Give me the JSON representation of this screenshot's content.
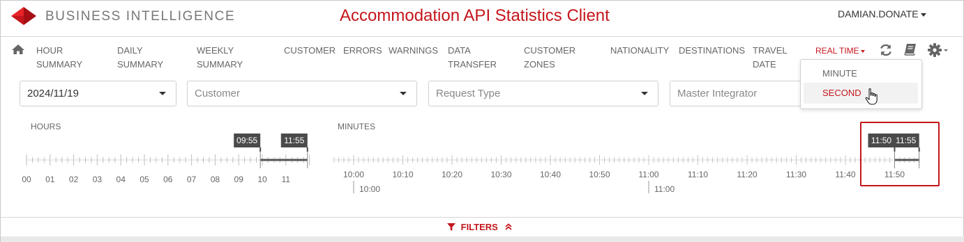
{
  "header": {
    "brand": "BUSINESS INTELLIGENCE",
    "app_title": "Accommodation API Statistics Client",
    "user": "DAMIAN.DONATE",
    "brand_color": "#c4161c"
  },
  "nav": {
    "home_icon": "home-icon",
    "items": [
      {
        "label": "HOUR\nSUMMARY"
      },
      {
        "label": "DAILY\nSUMMARY"
      },
      {
        "label": "WEEKLY\nSUMMARY"
      },
      {
        "label": "CUSTOMER"
      },
      {
        "label": "ERRORS"
      },
      {
        "label": "WARNINGS"
      },
      {
        "label": "DATA\nTRANSFER"
      },
      {
        "label": "CUSTOMER\nZONES"
      },
      {
        "label": "NATIONALITY"
      },
      {
        "label": "DESTINATIONS"
      },
      {
        "label": "TRAVEL\nDATE"
      }
    ],
    "realtime_label": "REAL TIME",
    "tools": [
      "refresh-icon",
      "book-icon",
      "gear-icon"
    ]
  },
  "realtime_menu": {
    "options": [
      "MINUTE",
      "SECOND"
    ],
    "selected": "SECOND"
  },
  "filters": {
    "date": {
      "value": "2024/11/19"
    },
    "customer": {
      "placeholder": "Customer"
    },
    "request_type": {
      "placeholder": "Request Type"
    },
    "master_integrator": {
      "placeholder": "Master Integrator"
    }
  },
  "hours_timeline": {
    "label": "HOURS",
    "ticks": [
      "00",
      "01",
      "02",
      "03",
      "04",
      "05",
      "06",
      "07",
      "08",
      "09",
      "10",
      "11"
    ],
    "range_start": "09:55",
    "range_end": "11:55"
  },
  "minutes_timeline": {
    "label": "MINUTES",
    "ticks": [
      "10:00",
      "10:10",
      "10:20",
      "10:30",
      "10:40",
      "10:50",
      "11:00",
      "11:10",
      "11:20",
      "11:30",
      "11:40",
      "11:50"
    ],
    "markers": [
      "10:00",
      "11:00"
    ],
    "range_start": "11:50",
    "range_end": "11:55"
  },
  "footer": {
    "filters_label": "FILTERS"
  }
}
